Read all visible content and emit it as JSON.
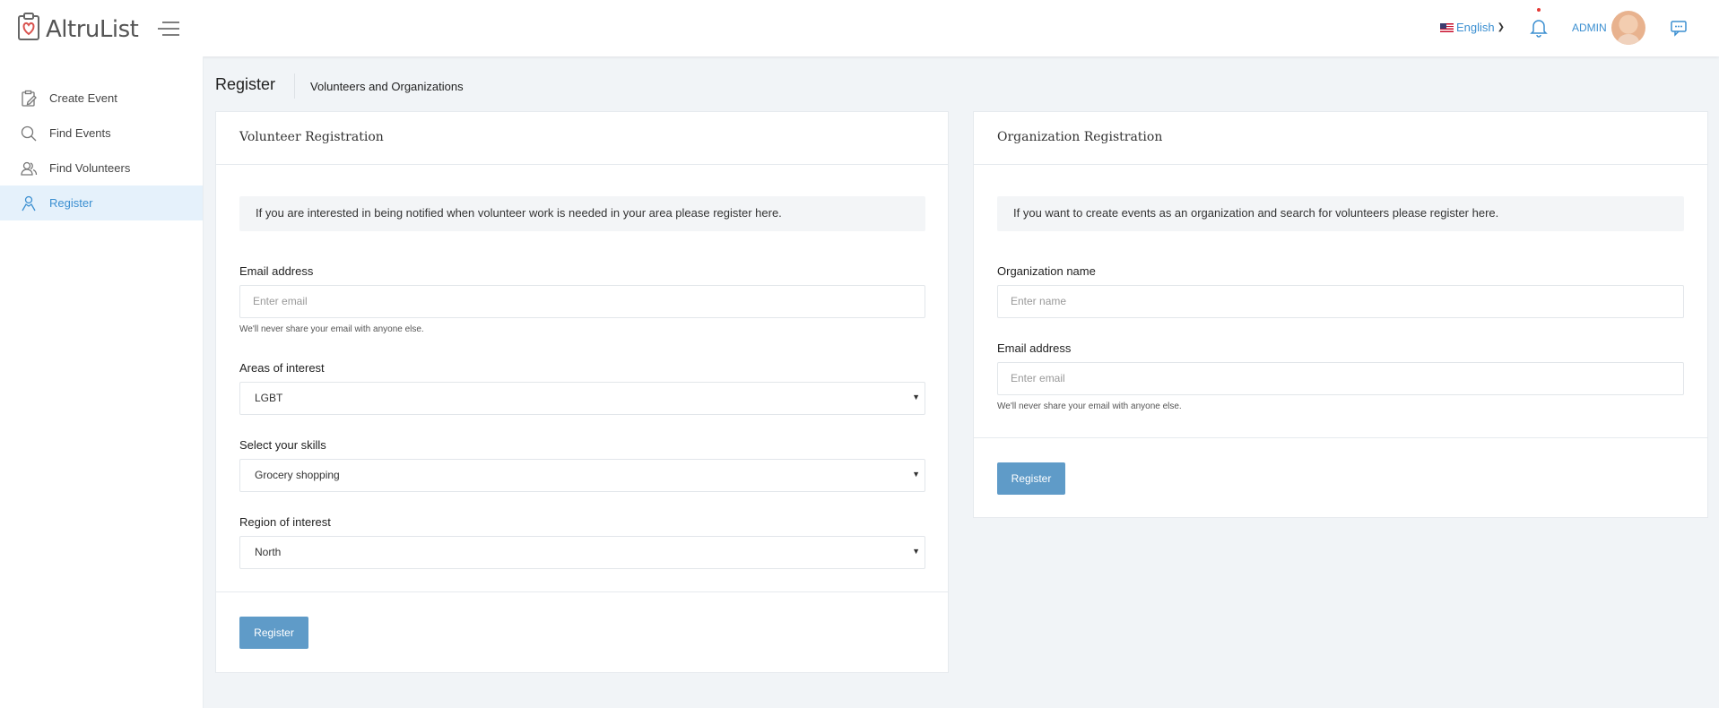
{
  "app": {
    "name": "AltruList"
  },
  "header": {
    "language": "English",
    "user_label": "ADMIN",
    "accent_color": "#3b8fd1"
  },
  "sidebar": {
    "items": [
      {
        "label": "Create Event",
        "icon": "clipboard-edit-icon",
        "active": false
      },
      {
        "label": "Find Events",
        "icon": "search-icon",
        "active": false
      },
      {
        "label": "Find Volunteers",
        "icon": "users-icon",
        "active": false
      },
      {
        "label": "Register",
        "icon": "user-icon",
        "active": true
      }
    ]
  },
  "page": {
    "title": "Register",
    "subtitle": "Volunteers and Organizations"
  },
  "volunteer": {
    "title": "Volunteer Registration",
    "info": "If you are interested in being notified when volunteer work is needed in your area please register here.",
    "email_label": "Email address",
    "email_placeholder": "Enter email",
    "email_hint": "We'll never share your email with anyone else.",
    "areas_label": "Areas of interest",
    "areas_value": "LGBT",
    "skills_label": "Select your skills",
    "skills_value": "Grocery shopping",
    "region_label": "Region of interest",
    "region_value": "North",
    "submit_label": "Register"
  },
  "organization": {
    "title": "Organization Registration",
    "info": "If you want to create events as an organization and search for volunteers please register here.",
    "name_label": "Organization name",
    "name_placeholder": "Enter name",
    "email_label": "Email address",
    "email_placeholder": "Enter email",
    "email_hint": "We'll never share your email with anyone else.",
    "submit_label": "Register"
  },
  "colors": {
    "button": "#5f9bc8",
    "active_sidebar_bg": "#e5f1fb",
    "page_bg": "#f1f4f7"
  }
}
